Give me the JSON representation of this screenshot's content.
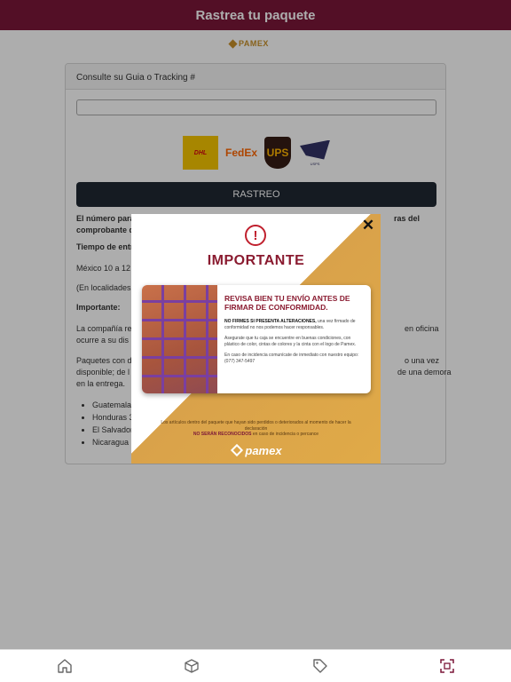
{
  "header": {
    "title": "Rastrea tu paquete"
  },
  "brand": {
    "logo_text": "PAMEX"
  },
  "tracking": {
    "label": "Consulte su Guia o Tracking #",
    "input_value": "",
    "button_label": "RASTREO",
    "carriers": [
      "DHL",
      "FedEx",
      "UPS",
      "USPS"
    ]
  },
  "info": {
    "line1_left": "El número para",
    "line1_right": "ras del",
    "line2_left": "comprobante d",
    "line3": "Tiempo de entr",
    "line4": "México 10 a 12",
    "line5": "(En localidades",
    "line6": "Importante:",
    "line7_left": "La compañía re",
    "line7_right": "en oficina",
    "line8": "ocurre a su dis",
    "line9_left": "Paquetes con d",
    "line9_right": "o una vez",
    "line10_left": "disponible; de l",
    "line10_right": "de una demora",
    "line11": "en la entrega.",
    "countries": [
      "Guatemala",
      "Honduras 3",
      "El Salvador",
      "Nicaragua"
    ]
  },
  "modal": {
    "title": "IMPORTANTE",
    "card_heading": "REVISA BIEN TU ENVÍO ANTES DE FIRMAR DE CONFORMIDAD.",
    "strong_notice": "NO FIRMES SI PRESENTA ALTERACIONES,",
    "notice_rest": "una vez firmado de conformidad no nos podemos hacer responsables.",
    "check_text": "Asegurate que tu caja se encuentre en buenas condiciones, con plástico de color, cintas de colores y la cinta con el logo de Pamex.",
    "contact_text": "En caso de incidencia comunícate de inmediato con nuestro equipo: (077) 347-5497",
    "footer_line": "Los artículos dentro del paquete que hayan sido perdidos o deteriorados al momento de hacer la declaración",
    "footer_strong": "NO SERÁN RECONOCIDOS",
    "footer_rest": "en caso de incidencia o percance",
    "logo_text": "pamex",
    "close_glyph": "✕",
    "warn_glyph": "!"
  },
  "nav": {
    "items": [
      "home-icon",
      "package-icon",
      "tag-icon",
      "scan-icon"
    ],
    "active_color": "#7b1738"
  },
  "colors": {
    "brand": "#7b1738",
    "gold": "#d9a24a",
    "button": "#1f2833"
  }
}
